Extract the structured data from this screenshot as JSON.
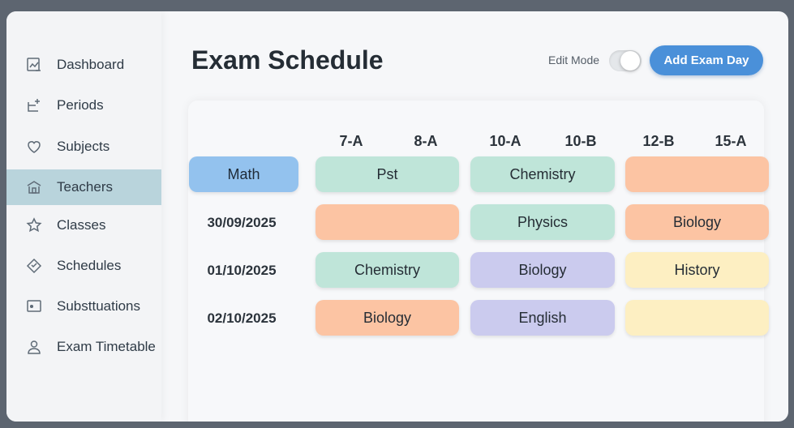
{
  "sidebar": {
    "items": [
      {
        "label": "Dashboard",
        "icon": "dashboard-icon"
      },
      {
        "label": "Periods",
        "icon": "periods-icon"
      },
      {
        "label": "Subjects",
        "icon": "heart-icon"
      },
      {
        "label": "Teachers",
        "icon": "school-icon",
        "active": true
      },
      {
        "label": "Classes",
        "icon": "star-icon"
      },
      {
        "label": "Schedules",
        "icon": "schedules-icon"
      },
      {
        "label": "Substtuations",
        "icon": "monitor-icon"
      },
      {
        "label": "Exam Timetable",
        "icon": "user-icon"
      }
    ]
  },
  "header": {
    "title": "Exam Schedule",
    "edit_mode_label": "Edit Mode",
    "edit_mode_on": true,
    "add_button_label": "Add Exam Day"
  },
  "schedule": {
    "columns": [
      "7-A",
      "8-A",
      "10-A",
      "10-B",
      "12-B",
      "15-A"
    ],
    "rows": [
      {
        "date": "Math",
        "cells": [
          "Pst",
          "Chemistry",
          ""
        ]
      },
      {
        "date": "30/09/2025",
        "cells": [
          "",
          "Physics",
          "Biology"
        ]
      },
      {
        "date": "01/10/2025",
        "cells": [
          "Chemistry",
          "Biology",
          "History"
        ]
      },
      {
        "date": "02/10/2025",
        "cells": [
          "Biology",
          "English",
          ""
        ]
      }
    ]
  },
  "colors": {
    "accent": "#4a90d9",
    "active_nav": "#b9d4dc",
    "math_chip": "#93c2ee",
    "green": "#bfe5d9",
    "orange": "#fcc4a3",
    "purple": "#cbcbee",
    "yellow": "#fdefc2"
  }
}
